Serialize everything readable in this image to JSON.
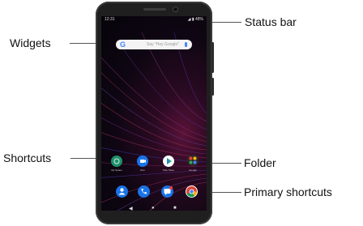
{
  "callouts": {
    "status_bar": "Status bar",
    "widgets": "Widgets",
    "shortcuts": "Shortcuts",
    "folder": "Folder",
    "primary_shortcuts": "Primary shortcuts"
  },
  "phone": {
    "status_time": "12:31",
    "status_right": "◢ ▮ 48%",
    "search_logo": "G",
    "search_placeholder": "Say \"Hey Google\"",
    "shortcuts": [
      {
        "label": "My Space",
        "color": "#1f8f6a",
        "icon": "space-icon"
      },
      {
        "label": "Duo",
        "color": "#1a73e8",
        "icon": "video-icon"
      },
      {
        "label": "Play Store",
        "color": "#ffffff",
        "icon": "play-icon"
      },
      {
        "label": "Google",
        "color": "#2b2b2b",
        "icon": "folder-icon"
      }
    ],
    "dock": [
      {
        "color": "#1a73e8",
        "icon": "contacts-icon"
      },
      {
        "color": "#1a73e8",
        "icon": "phone-icon"
      },
      {
        "color": "#1a73e8",
        "icon": "messages-icon"
      },
      {
        "color": "#ffffff",
        "icon": "chrome-icon"
      }
    ],
    "nav": {
      "back": "◀",
      "home": "●",
      "recents": "■"
    }
  }
}
